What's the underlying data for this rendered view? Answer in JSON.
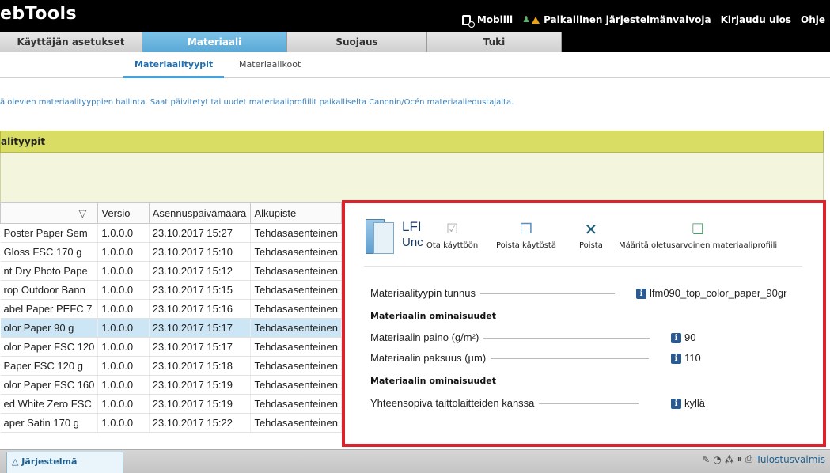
{
  "header": {
    "brand": "ebTools",
    "links": {
      "mobile": "Mobiili",
      "admin": "Paikallinen järjestelmänvalvoja",
      "logout": "Kirjaudu ulos",
      "help": "Ohje"
    }
  },
  "tabs": [
    {
      "label": "Käyttäjän asetukset"
    },
    {
      "label": "Materiaali"
    },
    {
      "label": "Suojaus"
    },
    {
      "label": "Tuki"
    }
  ],
  "subtabs": {
    "types": "Materiaalityypit",
    "sizes": "Materiaalikoot"
  },
  "description": "ä olevien materiaalityyppien hallinta. Saat päivitetyt tai uudet materiaaliprofiilit paikalliselta Canonin/Océn materiaaliedustajalta.",
  "panel": {
    "title": "alityypit"
  },
  "table": {
    "headers": [
      "▽",
      "Versio",
      "Asennuspäivämäärä",
      "Alkupiste"
    ],
    "rows": [
      [
        "Poster Paper Sem",
        "1.0.0.0",
        "23.10.2017 15:27",
        "Tehdasasenteinen"
      ],
      [
        "Gloss FSC 170 g",
        "1.0.0.0",
        "23.10.2017 15:10",
        "Tehdasasenteinen"
      ],
      [
        "nt Dry Photo Pape",
        "1.0.0.0",
        "23.10.2017 15:12",
        "Tehdasasenteinen"
      ],
      [
        "rop Outdoor Bann",
        "1.0.0.0",
        "23.10.2017 15:15",
        "Tehdasasenteinen"
      ],
      [
        "abel Paper PEFC 7",
        "1.0.0.0",
        "23.10.2017 15:16",
        "Tehdasasenteinen"
      ],
      [
        "olor Paper 90 g",
        "1.0.0.0",
        "23.10.2017 15:17",
        "Tehdasasenteinen"
      ],
      [
        "olor Paper FSC 120",
        "1.0.0.0",
        "23.10.2017 15:17",
        "Tehdasasenteinen"
      ],
      [
        "Paper FSC 120 g",
        "1.0.0.0",
        "23.10.2017 15:18",
        "Tehdasasenteinen"
      ],
      [
        "olor Paper FSC 160",
        "1.0.0.0",
        "23.10.2017 15:19",
        "Tehdasasenteinen"
      ],
      [
        "ed White Zero FSC",
        "1.0.0.0",
        "23.10.2017 15:19",
        "Tehdasasenteinen"
      ],
      [
        "aper Satin 170 g",
        "1.0.0.0",
        "23.10.2017 15:22",
        "Tehdasasenteinen"
      ]
    ],
    "selected_row": 5
  },
  "detail": {
    "name_line1": "LFI",
    "name_line2": "Unc",
    "toolbar": {
      "enable": "Ota käyttöön",
      "disable": "Poista käytöstä",
      "delete": "Poista",
      "set_default": "Määritä oletusarvoinen materiaaliprofiili"
    },
    "id_label": "Materiaalityypin tunnus",
    "id_value": "lfm090_top_color_paper_90gr",
    "section1": "Materiaalin ominaisuudet",
    "weight_label": "Materiaalin paino (g/m²)",
    "weight_value": "90",
    "thickness_label": "Materiaalin paksuus (µm)",
    "thickness_value": "110",
    "section2": "Materiaalin ominaisuudet",
    "folder_label": "Yhteensopiva taittolaitteiden kanssa",
    "folder_value": "kyllä"
  },
  "bottom": {
    "system_tab": "Järjestelmä",
    "status": "Tulostusvalmis"
  },
  "colors": {
    "accent": "#5aa9d6",
    "panel": "#d9dd63",
    "highlight": "#e0202a"
  }
}
